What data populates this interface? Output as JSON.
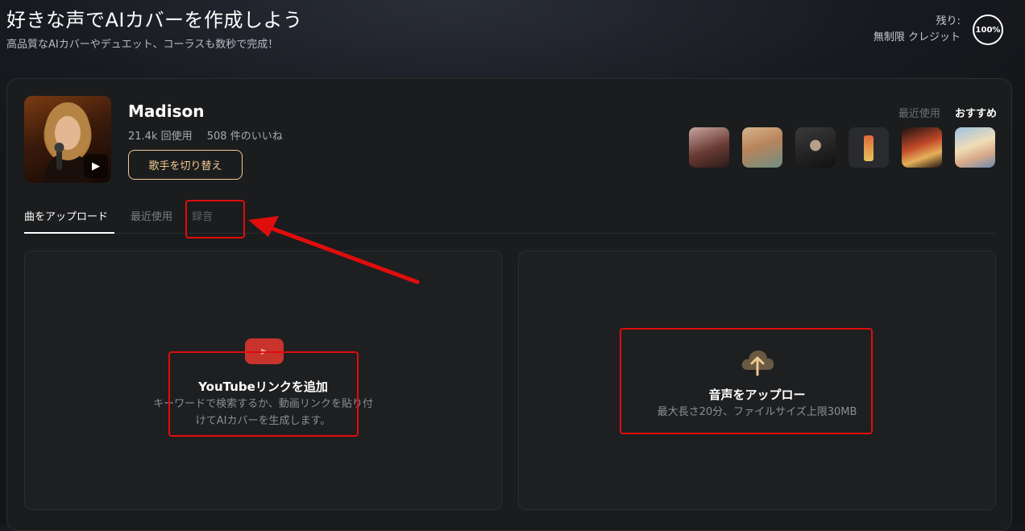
{
  "header": {
    "title": "好きな声でAIカバーを作成しよう",
    "subtitle": "高品質なAIカバーやデュエット、コーラスも数秒で完成！",
    "credits_label": "残り:",
    "credits_value": "無制限 クレジット",
    "credits_percent": "100%"
  },
  "singer": {
    "name": "Madison",
    "uses": "21.4k 回使用",
    "likes": "508 件のいいね",
    "switch_label": "歌手を切り替え",
    "play_icon": "play-icon"
  },
  "recommend": {
    "tabs": [
      {
        "label": "最近使用",
        "active": false
      },
      {
        "label": "おすすめ",
        "active": true
      }
    ]
  },
  "tabs": [
    {
      "label": "曲をアップロード",
      "active": true
    },
    {
      "label": "最近使用",
      "active": false
    },
    {
      "label": "録音",
      "active": false
    }
  ],
  "youtube_card": {
    "icon": "youtube-icon",
    "title": "YouTubeリンクを追加",
    "desc_line1": "キーワードで検索するか、動画リンクを貼り付",
    "desc_line2": "けてAIカバーを生成します。"
  },
  "upload_card": {
    "icon": "cloud-upload-icon",
    "title": "音声をアップロー",
    "desc": "最大長さ20分、ファイルサイズ上限30MB"
  },
  "colors": {
    "accent": "#f0c98f",
    "highlight": "#e00d0d",
    "youtube": "#c8332c"
  }
}
